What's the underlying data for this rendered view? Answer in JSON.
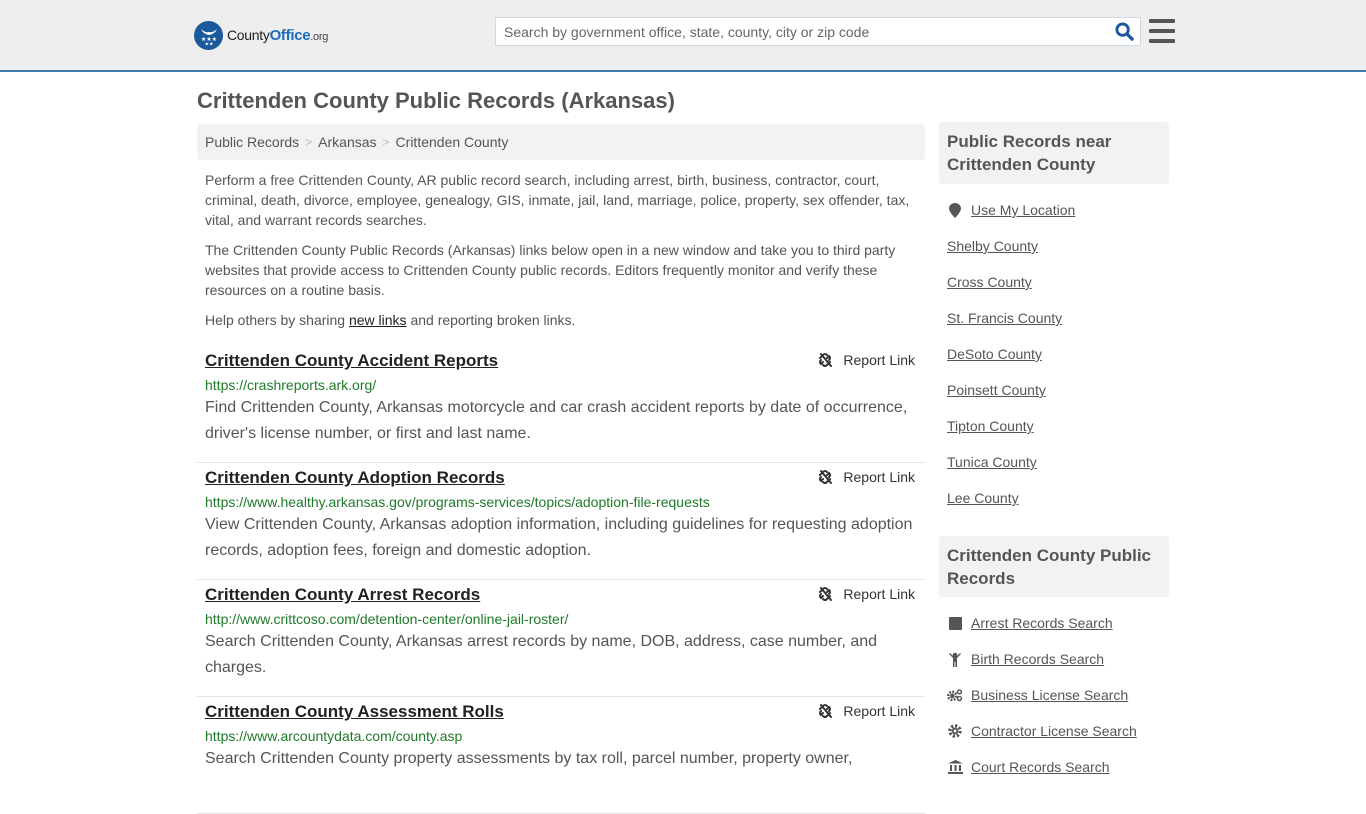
{
  "header": {
    "logo": {
      "name": "County",
      "highlight": "Office",
      "tld": ".org"
    },
    "search": {
      "placeholder": "Search by government office, state, county, city or zip code",
      "value": ""
    },
    "colors": {
      "accent": "#3e79ab",
      "brand": "#1a5a9c",
      "url_green": "#1f7a2a"
    }
  },
  "page": {
    "title": "Crittenden County Public Records (Arkansas)"
  },
  "breadcrumb": [
    {
      "label": "Public Records"
    },
    {
      "label": "Arkansas"
    },
    {
      "label": "Crittenden County"
    }
  ],
  "intro": {
    "p1": "Perform a free Crittenden County, AR public record search, including arrest, birth, business, contractor, court, criminal, death, divorce, employee, genealogy, GIS, inmate, jail, land, marriage, police, property, sex offender, tax, vital, and warrant records searches.",
    "p2": "The Crittenden County Public Records (Arkansas) links below open in a new window and take you to third party websites that provide access to Crittenden County public records. Editors frequently monitor and verify these resources on a routine basis.",
    "p3_before": "Help others by sharing ",
    "p3_link": "new links",
    "p3_after": " and reporting broken links."
  },
  "records": [
    {
      "title": "Crittenden County Accident Reports",
      "url": "https://crashreports.ark.org/",
      "description": "Find Crittenden County, Arkansas motorcycle and car crash accident reports by date of occurrence, driver's license number, or first and last name.",
      "report_label": "Report Link"
    },
    {
      "title": "Crittenden County Adoption Records",
      "url": "https://www.healthy.arkansas.gov/programs-services/topics/adoption-file-requests",
      "description": "View Crittenden County, Arkansas adoption information, including guidelines for requesting adoption records, adoption fees, foreign and domestic adoption.",
      "report_label": "Report Link"
    },
    {
      "title": "Crittenden County Arrest Records",
      "url": "http://www.crittcoso.com/detention-center/online-jail-roster/",
      "description": "Search Crittenden County, Arkansas arrest records by name, DOB, address, case number, and charges.",
      "report_label": "Report Link"
    },
    {
      "title": "Crittenden County Assessment Rolls",
      "url": "https://www.arcountydata.com/county.asp",
      "description": "Search Crittenden County property assessments by tax roll, parcel number, property owner,",
      "report_label": "Report Link"
    }
  ],
  "sidebar": {
    "nearby": {
      "heading": "Public Records near Crittenden County",
      "use_location": "Use My Location",
      "counties": [
        "Shelby County",
        "Cross County",
        "St. Francis County",
        "DeSoto County",
        "Poinsett County",
        "Tipton County",
        "Tunica County",
        "Lee County"
      ]
    },
    "county_records": {
      "heading": "Crittenden County Public Records",
      "items": [
        {
          "label": "Arrest Records Search",
          "icon": "square-icon"
        },
        {
          "label": "Birth Records Search",
          "icon": "child-icon"
        },
        {
          "label": "Business License Search",
          "icon": "gears-icon"
        },
        {
          "label": "Contractor License Search",
          "icon": "gear-icon"
        },
        {
          "label": "Court Records Search",
          "icon": "courthouse-icon"
        }
      ]
    }
  }
}
